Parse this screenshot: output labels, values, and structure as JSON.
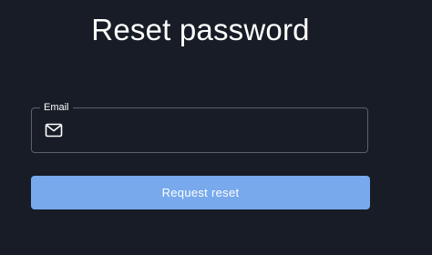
{
  "page": {
    "title": "Reset password"
  },
  "email_field": {
    "label": "Email",
    "value": "",
    "icon": "mail-icon"
  },
  "submit": {
    "label": "Request reset"
  },
  "colors": {
    "background": "#171c26",
    "button": "#77a9ec",
    "field_border": "#5b6069",
    "text": "#ffffff"
  }
}
